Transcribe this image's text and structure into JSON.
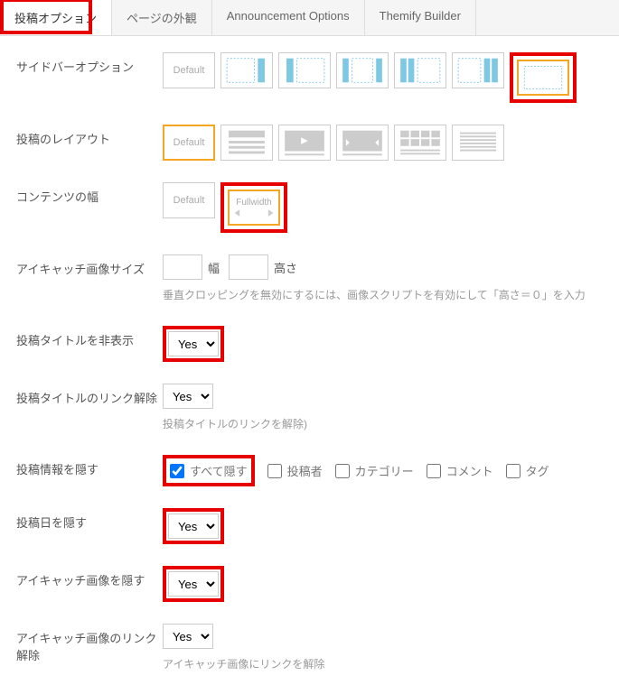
{
  "tabs": [
    {
      "label": "投稿オプション",
      "active": true
    },
    {
      "label": "ページの外観",
      "active": false
    },
    {
      "label": "Announcement Options",
      "active": false
    },
    {
      "label": "Themify Builder",
      "active": false
    }
  ],
  "rows": {
    "sidebar": {
      "label": "サイドバーオプション",
      "default_text": "Default"
    },
    "layout": {
      "label": "投稿のレイアウト",
      "default_text": "Default"
    },
    "width": {
      "label": "コンテンツの幅",
      "default_text": "Default",
      "fullwidth_text": "Fullwidth"
    },
    "imgsize": {
      "label": "アイキャッチ画像サイズ",
      "width_label": "幅",
      "height_label": "高さ",
      "hint": "垂直クロッピングを無効にするには、画像スクリプトを有効にして「高さ＝０」を入力"
    },
    "hide_title": {
      "label": "投稿タイトルを非表示",
      "value": "Yes"
    },
    "unlink_title": {
      "label": "投稿タイトルのリンク解除",
      "value": "Yes",
      "hint": "投稿タイトルのリンクを解除)"
    },
    "hide_meta": {
      "label": "投稿情報を隠す",
      "checks": [
        {
          "label": "すべて隠す",
          "checked": true
        },
        {
          "label": "投稿者",
          "checked": false
        },
        {
          "label": "カテゴリー",
          "checked": false
        },
        {
          "label": "コメント",
          "checked": false
        },
        {
          "label": "タグ",
          "checked": false
        }
      ]
    },
    "hide_date": {
      "label": "投稿日を隠す",
      "value": "Yes"
    },
    "hide_image": {
      "label": "アイキャッチ画像を隠す",
      "value": "Yes"
    },
    "unlink_image": {
      "label": "アイキャッチ画像のリンク解除",
      "value": "Yes",
      "hint": "アイキャッチ画像にリンクを解除"
    }
  }
}
